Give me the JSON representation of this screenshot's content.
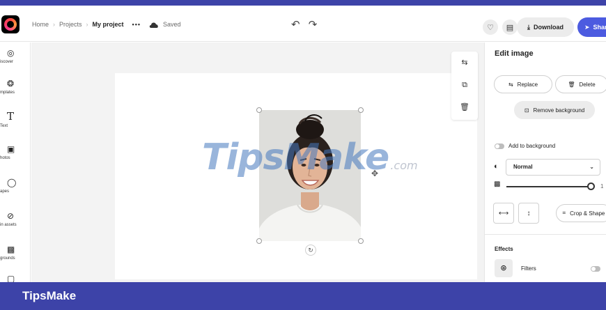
{
  "header": {
    "breadcrumbs": [
      "Home",
      "Projects"
    ],
    "project_name": "My project",
    "more_label": "•••",
    "save_status": "Saved",
    "undo_redo": "↶ ↷",
    "download_label": "Download",
    "share_label": "Share"
  },
  "sidebar": {
    "items": [
      {
        "label": "iscover",
        "icon": "discover-icon"
      },
      {
        "label": "mplates",
        "icon": "templates-icon"
      },
      {
        "label": "Text",
        "icon": "text-icon"
      },
      {
        "label": "hotos",
        "icon": "photos-icon"
      },
      {
        "label": "apes",
        "icon": "shapes-icon"
      },
      {
        "label": "in assets",
        "icon": "assets-icon"
      },
      {
        "label": "grounds",
        "icon": "backgrounds-icon"
      }
    ]
  },
  "canvas": {
    "watermark_main": "TipsMake",
    "watermark_domain": ".com"
  },
  "panel": {
    "title": "Edit image",
    "replace_label": "Replace",
    "delete_label": "Delete",
    "remove_bg_label": "Remove background",
    "add_to_bg_label": "Add to background",
    "blend_mode": "Normal",
    "opacity_value": "1",
    "crop_label": "Crop & Shape",
    "effects_title": "Effects",
    "filters_label": "Filters"
  },
  "footer": {
    "brand": "TipsMake"
  },
  "colors": {
    "accent": "#4c5be0",
    "banner": "#3d43a8"
  }
}
